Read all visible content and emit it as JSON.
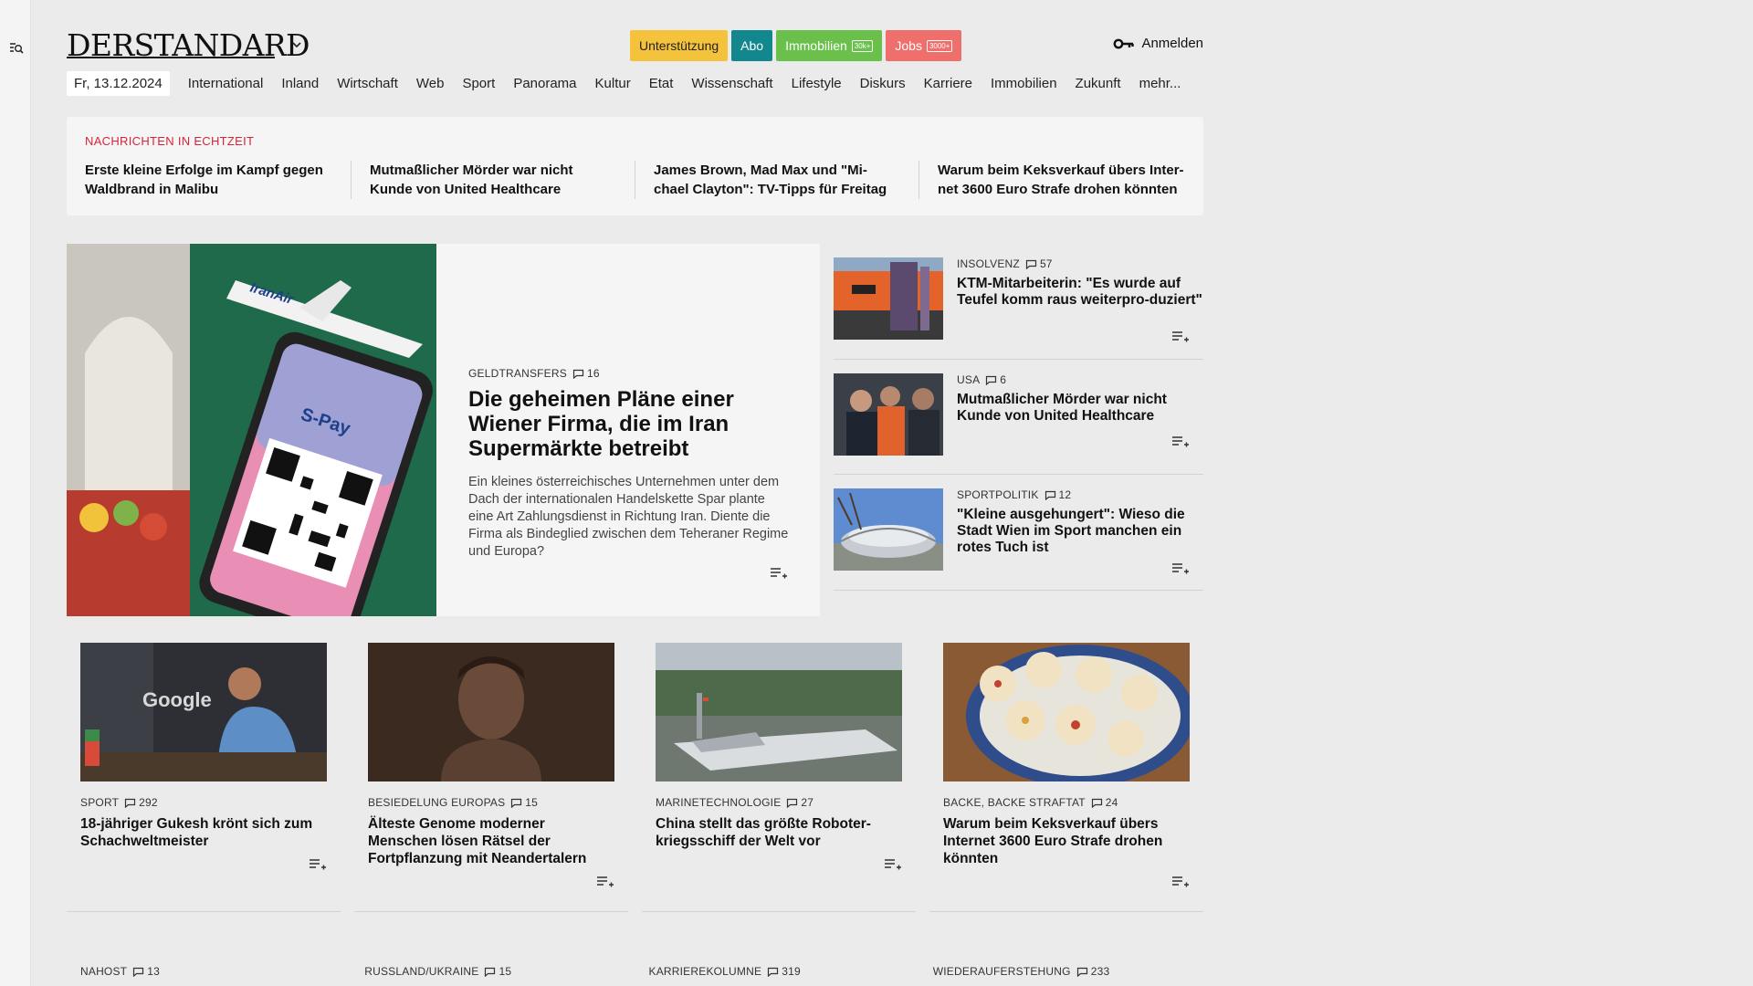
{
  "brand": {
    "logo_text": "DERSTANDARD"
  },
  "header": {
    "buttons": {
      "support": "Unterstützung",
      "abo": "Abo",
      "immobilien": "Immobilien",
      "immobilien_badge": "30k+",
      "jobs": "Jobs",
      "jobs_badge": "3000+"
    },
    "login": "Anmelden"
  },
  "nav": {
    "date": "Fr, 13.12.2024",
    "items": [
      "International",
      "Inland",
      "Wirtschaft",
      "Web",
      "Sport",
      "Panorama",
      "Kultur",
      "Etat",
      "Wissenschaft",
      "Lifestyle",
      "Diskurs",
      "Karriere",
      "Immobilien",
      "Zukunft",
      "mehr..."
    ]
  },
  "ticker": {
    "label": "NACHRICHTEN IN ECHTZEIT",
    "items": [
      "Erste kleine Erfolge im Kampf gegen Waldbrand in Malibu",
      "Mutmaßlicher Mörder war nicht Kunde von United Healthcare",
      "James Brown, Mad Max und \"Mi-chael Clayton\": TV-Tipps für Freitag",
      "Warum beim Keksverkauf übers Inter-net 3600 Euro Strafe drohen könnten"
    ]
  },
  "lead": {
    "kicker": "GELDTRANSFERS",
    "comments": "16",
    "title": "Die geheimen Pläne einer Wiener Firma, die im Iran Supermärkte betreibt",
    "teaser": "Ein kleines österreichisches Unternehmen unter dem Dach der internationalen Handelskette Spar plante eine Art Zahlungsdienst in Richtung Iran. Diente die Firma als Bindeglied zwischen dem Teheraner Regime und Europa?",
    "image_text_airline": "IranAir",
    "image_text_app": "S-Pay"
  },
  "side": [
    {
      "kicker": "INSOLVENZ",
      "comments": "57",
      "title": "KTM-Mitarbeiterin: \"Es wurde auf Teufel komm raus weiterpro-duziert\""
    },
    {
      "kicker": "USA",
      "comments": "6",
      "title": "Mutmaßlicher Mörder war nicht Kunde von United Healthcare"
    },
    {
      "kicker": "SPORTPOLITIK",
      "comments": "12",
      "title": "\"Kleine ausgehungert\": Wieso die Stadt Wien im Sport manchen ein rotes Tuch ist"
    }
  ],
  "grid": [
    {
      "kicker": "SPORT",
      "comments": "292",
      "title": "18-jähriger Gukesh krönt sich zum Schachweltmeister",
      "image_text": "Google"
    },
    {
      "kicker": "BESIEDELUNG EUROPAS",
      "comments": "15",
      "title": "Älteste Genome moderner Menschen lösen Rätsel der Fortpflanzung mit Neandertalern"
    },
    {
      "kicker": "MARINETECHNOLOGIE",
      "comments": "27",
      "title": "China stellt das größte Roboter-kriegsschiff der Welt vor"
    },
    {
      "kicker": "BACKE, BACKE STRAFTAT",
      "comments": "24",
      "title": "Warum beim Keksverkauf übers Internet 3600 Euro Strafe drohen könnten"
    }
  ],
  "bottom": [
    {
      "kicker": "NAHOST",
      "comments": "13"
    },
    {
      "kicker": "RUSSLAND/UKRAINE",
      "comments": "15"
    },
    {
      "kicker": "KARRIEREKOLUMNE",
      "comments": "319"
    },
    {
      "kicker": "WIEDERAUFERSTEHUNG",
      "comments": "233"
    }
  ],
  "colors": {
    "accent_red": "#d6243b",
    "support": "#f5c33b",
    "abo": "#13878e",
    "immobilien": "#6bc04b",
    "jobs": "#ef6f6c"
  }
}
